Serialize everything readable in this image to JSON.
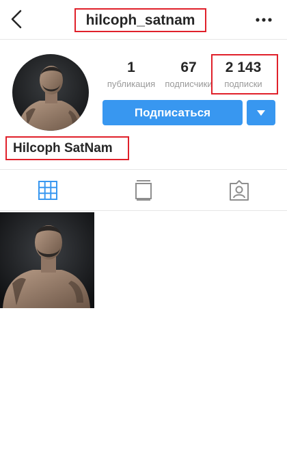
{
  "header": {
    "username": "hilcoph_satnam",
    "back_icon": "chevron-left-icon",
    "more_icon": "more-dots-icon"
  },
  "profile": {
    "avatar_alt": "profile photo",
    "full_name": "Hilcoph SatNam",
    "stats": {
      "posts_value": "1",
      "posts_label": "публикация",
      "followers_value": "67",
      "followers_label": "подписчики",
      "following_value": "2 143",
      "following_label": "подписки"
    }
  },
  "actions": {
    "follow_label": "Подписаться",
    "dropdown_icon": "caret-down-icon"
  },
  "tabs": [
    {
      "icon": "grid-icon",
      "active": true
    },
    {
      "icon": "feed-icon",
      "active": false
    },
    {
      "icon": "tagged-icon",
      "active": false
    }
  ],
  "colors": {
    "accent": "#3897f0",
    "highlight_box": "#e0202a",
    "muted_text": "#999999"
  }
}
